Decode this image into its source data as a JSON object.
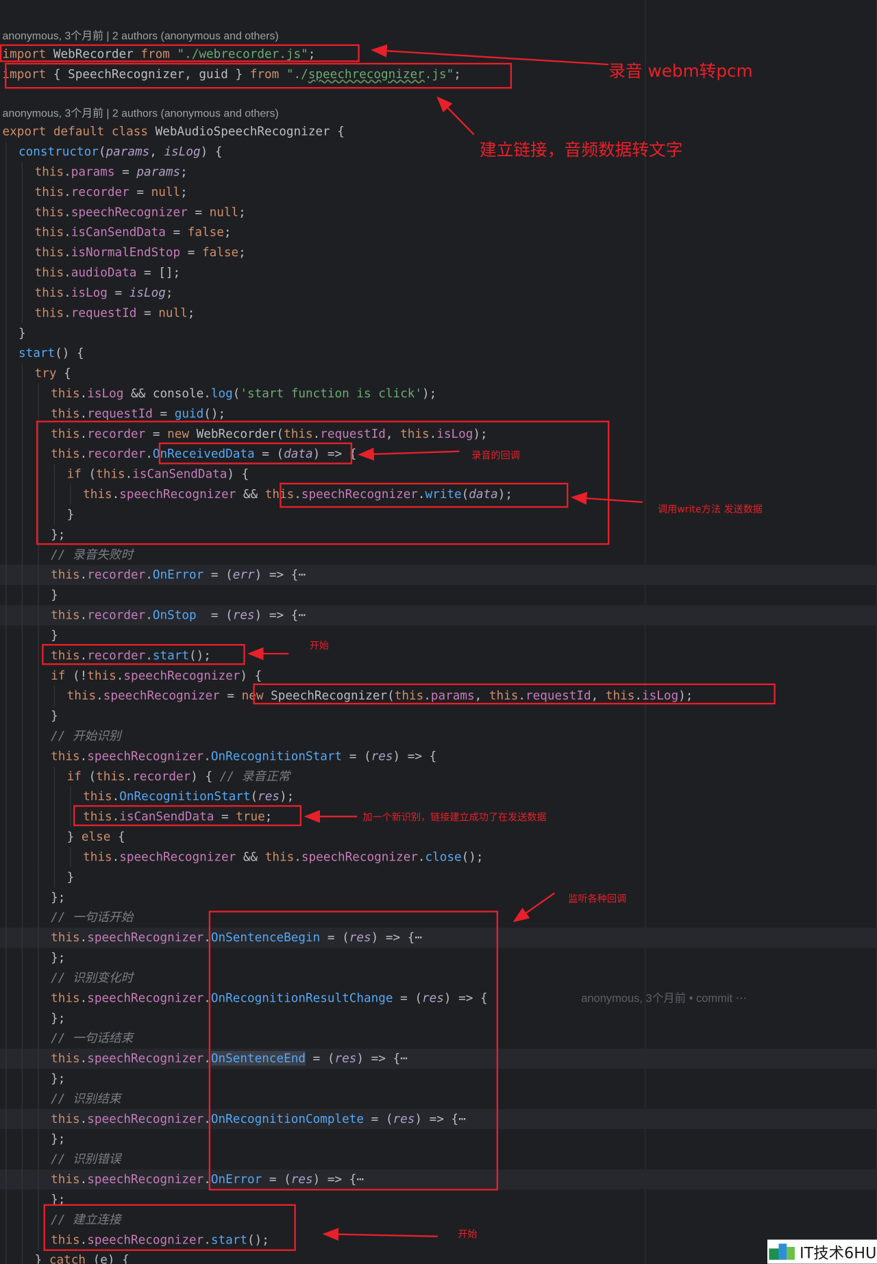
{
  "blame": {
    "import_block": "anonymous, 3个月前 | 2 authors (anonymous and others)",
    "class_block": "anonymous, 3个月前 | 2 authors (anonymous and others)"
  },
  "inlay_blame": "anonymous, 3个月前 • commit ⋯",
  "annotations": {
    "import_recorder": "录音 webm转pcm",
    "import_recognizer": "建立链接，音频数据转文字",
    "on_received_data": "录音的回调",
    "write_call": "调用write方法 发送数据",
    "recorder_start": "开始",
    "can_send_flag": "加一个新识别，链接建立成功了在发送数据",
    "listeners": "监听各种回调",
    "connect_start": "开始"
  },
  "watermark": {
    "text": "IT技术6HU"
  },
  "colors": {
    "editor_bg": "#1e1f22",
    "annotation_red": "#e8202a"
  }
}
